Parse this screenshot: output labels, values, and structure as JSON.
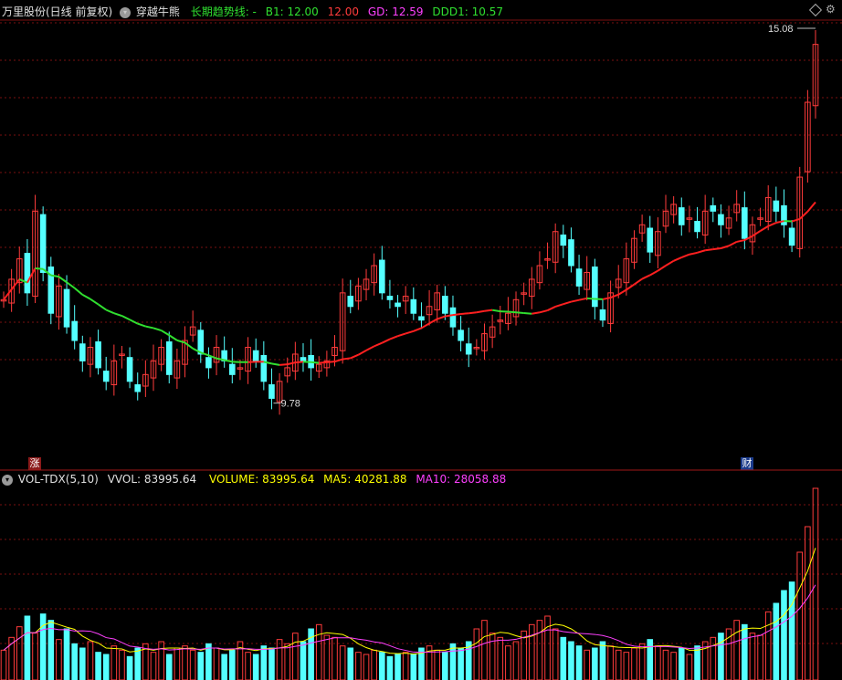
{
  "price_panel": {
    "title": "万里股份(日线 前复权)",
    "indicator_name": "穿越牛熊",
    "trend_label": "长期趋势线: -",
    "b1_label": "B1: 12.00",
    "b1_value": "12.00",
    "gd_label": "GD: 12.59",
    "ddd1_label": "DDD1: 10.57",
    "high_marker": "15.08",
    "low_marker": "9.78",
    "left_tag": "涨",
    "right_tag": "财"
  },
  "volume_panel": {
    "title": "VOL-TDX(5,10)",
    "vvol_label": "VVOL: 83995.64",
    "volume_label": "VOLUME: 83995.64",
    "ma5_label": "MA5: 40281.88",
    "ma10_label": "MA10: 28058.88"
  },
  "colors": {
    "up": "#ff3b3b",
    "down": "#54ffff",
    "grid": "#7a1010",
    "trend_red": "#ff2020",
    "trend_green": "#30e030",
    "ma5": "#ffff00",
    "ma10": "#ff40ff"
  },
  "chart_data": {
    "type": "candlestick",
    "price_range": [
      9.4,
      15.3
    ],
    "close": [
      11.3,
      11.6,
      11.9,
      11.4,
      12.6,
      11.7,
      11.1,
      11.5,
      10.9,
      10.7,
      10.4,
      10.6,
      10.3,
      10.1,
      10.4,
      10.5,
      10.1,
      9.95,
      10.2,
      10.4,
      10.6,
      10.2,
      10.4,
      10.7,
      10.9,
      10.5,
      10.3,
      10.6,
      10.4,
      10.2,
      10.3,
      10.6,
      10.4,
      10.1,
      9.85,
      10.1,
      10.3,
      10.5,
      10.4,
      10.3,
      10.35,
      10.4,
      10.6,
      11.4,
      11.2,
      11.5,
      11.6,
      11.8,
      11.4,
      11.3,
      11.2,
      11.35,
      11.1,
      11.0,
      11.2,
      11.4,
      11.1,
      10.9,
      10.7,
      10.5,
      10.6,
      10.8,
      10.9,
      11.0,
      11.1,
      11.3,
      11.4,
      11.6,
      11.8,
      11.9,
      12.3,
      12.1,
      11.8,
      11.5,
      11.7,
      11.2,
      11.0,
      11.4,
      11.6,
      11.9,
      12.2,
      12.4,
      12.0,
      12.3,
      12.6,
      12.7,
      12.4,
      12.5,
      12.3,
      12.6,
      12.6,
      12.4,
      12.5,
      12.7,
      12.2,
      12.4,
      12.5,
      12.8,
      12.6,
      12.4,
      12.1,
      13.1,
      14.2,
      15.05
    ],
    "volume": [
      14000,
      20000,
      25000,
      30000,
      22000,
      31000,
      28000,
      19000,
      24000,
      17000,
      15000,
      18000,
      13000,
      12000,
      16000,
      14000,
      11000,
      15000,
      17000,
      13000,
      18000,
      12000,
      15000,
      16000,
      14000,
      13000,
      17000,
      15000,
      12000,
      14000,
      18000,
      13000,
      12000,
      16000,
      15000,
      19000,
      17000,
      22000,
      18000,
      24000,
      26000,
      21000,
      20000,
      16000,
      15000,
      13000,
      12000,
      14000,
      13000,
      11000,
      12000,
      13000,
      12000,
      15000,
      16000,
      14000,
      13000,
      17000,
      15000,
      18000,
      24000,
      28000,
      22000,
      20000,
      16000,
      18000,
      23000,
      26000,
      28000,
      30000,
      24000,
      20000,
      18000,
      16000,
      14000,
      15000,
      18000,
      16000,
      14000,
      13000,
      15000,
      17000,
      19000,
      16000,
      14000,
      13000,
      15000,
      12000,
      16000,
      18000,
      20000,
      22000,
      24000,
      28000,
      26000,
      22000,
      21000,
      32000,
      36000,
      42000,
      46000,
      60000,
      72000,
      90000
    ],
    "long_trend_line": "smooth line, green in falling stretch, red in rising stretch",
    "ma5": "yellow line",
    "ma10": "magenta line"
  }
}
